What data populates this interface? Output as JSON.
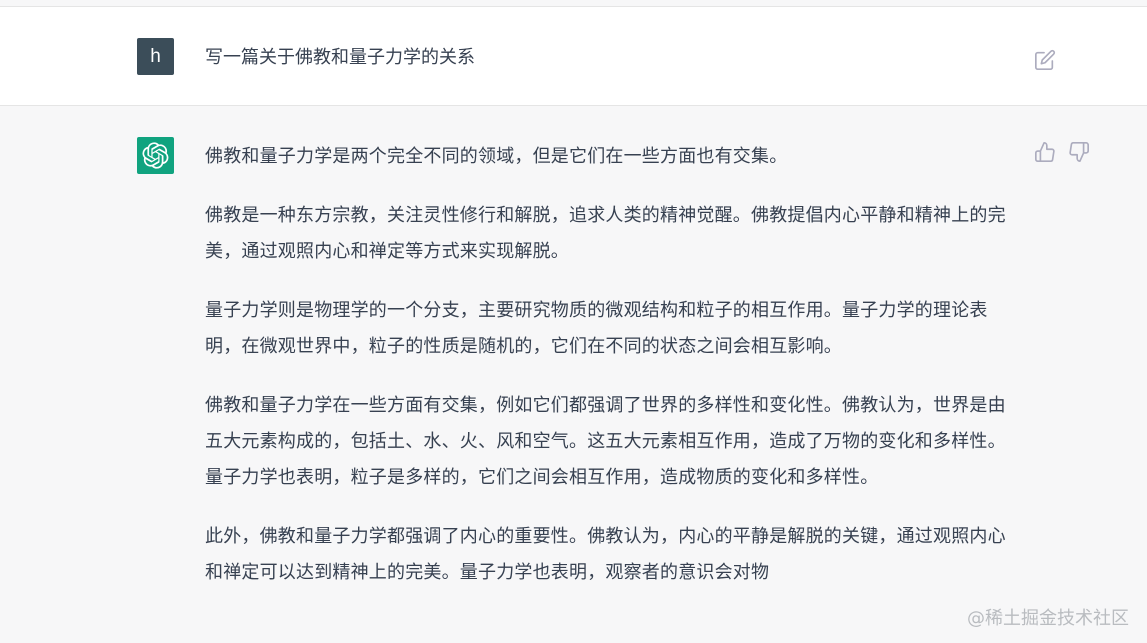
{
  "user_message": {
    "avatar_letter": "h",
    "text": "写一篇关于佛教和量子力学的关系",
    "avatar_color": "#3b4d59"
  },
  "assistant_message": {
    "avatar_color": "#10a37f",
    "paragraphs": [
      "佛教和量子力学是两个完全不同的领域，但是它们在一些方面也有交集。",
      "佛教是一种东方宗教，关注灵性修行和解脱，追求人类的精神觉醒。佛教提倡内心平静和精神上的完美，通过观照内心和禅定等方式来实现解脱。",
      "量子力学则是物理学的一个分支，主要研究物质的微观结构和粒子的相互作用。量子力学的理论表明，在微观世界中，粒子的性质是随机的，它们在不同的状态之间会相互影响。",
      "佛教和量子力学在一些方面有交集，例如它们都强调了世界的多样性和变化性。佛教认为，世界是由五大元素构成的，包括土、水、火、风和空气。这五大元素相互作用，造成了万物的变化和多样性。量子力学也表明，粒子是多样的，它们之间会相互作用，造成物质的变化和多样性。",
      "此外，佛教和量子力学都强调了内心的重要性。佛教认为，内心的平静是解脱的关键，通过观照内心和禅定可以达到精神上的完美。量子力学也表明，观察者的意识会对物"
    ]
  },
  "icons": {
    "edit": "edit-icon",
    "thumb_up": "thumb-up-icon",
    "thumb_down": "thumb-down-icon",
    "bot_logo": "openai-logo-icon"
  },
  "watermark": "@稀土掘金技术社区"
}
